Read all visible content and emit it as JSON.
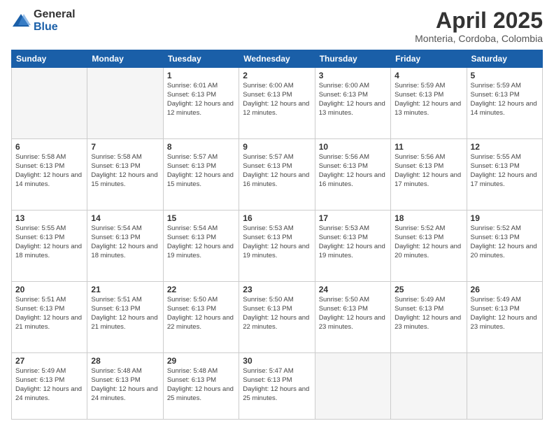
{
  "logo": {
    "general": "General",
    "blue": "Blue"
  },
  "title": "April 2025",
  "subtitle": "Monteria, Cordoba, Colombia",
  "days_header": [
    "Sunday",
    "Monday",
    "Tuesday",
    "Wednesday",
    "Thursday",
    "Friday",
    "Saturday"
  ],
  "weeks": [
    [
      {
        "day": "",
        "info": ""
      },
      {
        "day": "",
        "info": ""
      },
      {
        "day": "1",
        "info": "Sunrise: 6:01 AM\nSunset: 6:13 PM\nDaylight: 12 hours\nand 12 minutes."
      },
      {
        "day": "2",
        "info": "Sunrise: 6:00 AM\nSunset: 6:13 PM\nDaylight: 12 hours\nand 12 minutes."
      },
      {
        "day": "3",
        "info": "Sunrise: 6:00 AM\nSunset: 6:13 PM\nDaylight: 12 hours\nand 13 minutes."
      },
      {
        "day": "4",
        "info": "Sunrise: 5:59 AM\nSunset: 6:13 PM\nDaylight: 12 hours\nand 13 minutes."
      },
      {
        "day": "5",
        "info": "Sunrise: 5:59 AM\nSunset: 6:13 PM\nDaylight: 12 hours\nand 14 minutes."
      }
    ],
    [
      {
        "day": "6",
        "info": "Sunrise: 5:58 AM\nSunset: 6:13 PM\nDaylight: 12 hours\nand 14 minutes."
      },
      {
        "day": "7",
        "info": "Sunrise: 5:58 AM\nSunset: 6:13 PM\nDaylight: 12 hours\nand 15 minutes."
      },
      {
        "day": "8",
        "info": "Sunrise: 5:57 AM\nSunset: 6:13 PM\nDaylight: 12 hours\nand 15 minutes."
      },
      {
        "day": "9",
        "info": "Sunrise: 5:57 AM\nSunset: 6:13 PM\nDaylight: 12 hours\nand 16 minutes."
      },
      {
        "day": "10",
        "info": "Sunrise: 5:56 AM\nSunset: 6:13 PM\nDaylight: 12 hours\nand 16 minutes."
      },
      {
        "day": "11",
        "info": "Sunrise: 5:56 AM\nSunset: 6:13 PM\nDaylight: 12 hours\nand 17 minutes."
      },
      {
        "day": "12",
        "info": "Sunrise: 5:55 AM\nSunset: 6:13 PM\nDaylight: 12 hours\nand 17 minutes."
      }
    ],
    [
      {
        "day": "13",
        "info": "Sunrise: 5:55 AM\nSunset: 6:13 PM\nDaylight: 12 hours\nand 18 minutes."
      },
      {
        "day": "14",
        "info": "Sunrise: 5:54 AM\nSunset: 6:13 PM\nDaylight: 12 hours\nand 18 minutes."
      },
      {
        "day": "15",
        "info": "Sunrise: 5:54 AM\nSunset: 6:13 PM\nDaylight: 12 hours\nand 19 minutes."
      },
      {
        "day": "16",
        "info": "Sunrise: 5:53 AM\nSunset: 6:13 PM\nDaylight: 12 hours\nand 19 minutes."
      },
      {
        "day": "17",
        "info": "Sunrise: 5:53 AM\nSunset: 6:13 PM\nDaylight: 12 hours\nand 19 minutes."
      },
      {
        "day": "18",
        "info": "Sunrise: 5:52 AM\nSunset: 6:13 PM\nDaylight: 12 hours\nand 20 minutes."
      },
      {
        "day": "19",
        "info": "Sunrise: 5:52 AM\nSunset: 6:13 PM\nDaylight: 12 hours\nand 20 minutes."
      }
    ],
    [
      {
        "day": "20",
        "info": "Sunrise: 5:51 AM\nSunset: 6:13 PM\nDaylight: 12 hours\nand 21 minutes."
      },
      {
        "day": "21",
        "info": "Sunrise: 5:51 AM\nSunset: 6:13 PM\nDaylight: 12 hours\nand 21 minutes."
      },
      {
        "day": "22",
        "info": "Sunrise: 5:50 AM\nSunset: 6:13 PM\nDaylight: 12 hours\nand 22 minutes."
      },
      {
        "day": "23",
        "info": "Sunrise: 5:50 AM\nSunset: 6:13 PM\nDaylight: 12 hours\nand 22 minutes."
      },
      {
        "day": "24",
        "info": "Sunrise: 5:50 AM\nSunset: 6:13 PM\nDaylight: 12 hours\nand 23 minutes."
      },
      {
        "day": "25",
        "info": "Sunrise: 5:49 AM\nSunset: 6:13 PM\nDaylight: 12 hours\nand 23 minutes."
      },
      {
        "day": "26",
        "info": "Sunrise: 5:49 AM\nSunset: 6:13 PM\nDaylight: 12 hours\nand 23 minutes."
      }
    ],
    [
      {
        "day": "27",
        "info": "Sunrise: 5:49 AM\nSunset: 6:13 PM\nDaylight: 12 hours\nand 24 minutes."
      },
      {
        "day": "28",
        "info": "Sunrise: 5:48 AM\nSunset: 6:13 PM\nDaylight: 12 hours\nand 24 minutes."
      },
      {
        "day": "29",
        "info": "Sunrise: 5:48 AM\nSunset: 6:13 PM\nDaylight: 12 hours\nand 25 minutes."
      },
      {
        "day": "30",
        "info": "Sunrise: 5:47 AM\nSunset: 6:13 PM\nDaylight: 12 hours\nand 25 minutes."
      },
      {
        "day": "",
        "info": ""
      },
      {
        "day": "",
        "info": ""
      },
      {
        "day": "",
        "info": ""
      }
    ]
  ]
}
